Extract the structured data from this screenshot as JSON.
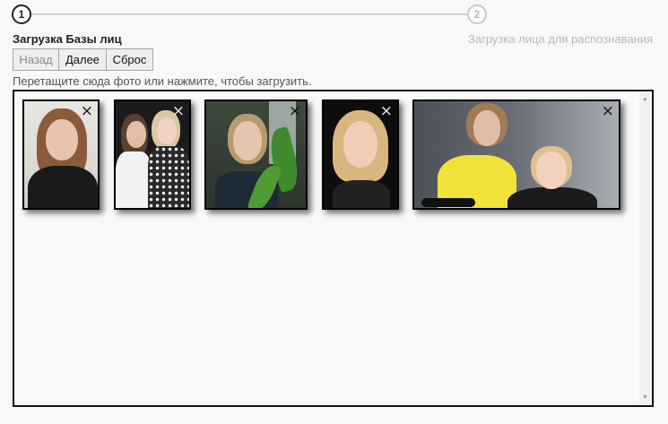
{
  "stepper": {
    "step1_number": "1",
    "step2_number": "2",
    "step1_title": "Загрузка Базы лиц",
    "step2_title": "Загрузка лица для распознавания"
  },
  "buttons": {
    "back": "Назад",
    "next": "Далее",
    "reset": "Сброс"
  },
  "dropzone": {
    "hint": "Перетащите сюда фото или нажмите, чтобы загрузить."
  },
  "thumbnails": [
    {
      "name": "photo-1",
      "remove": "×"
    },
    {
      "name": "photo-2",
      "remove": "×"
    },
    {
      "name": "photo-3",
      "remove": "×"
    },
    {
      "name": "photo-4",
      "remove": "×"
    },
    {
      "name": "photo-5",
      "remove": "×"
    }
  ],
  "scrollbar": {
    "up": "▲",
    "down": "▼"
  },
  "icons": [
    "close-icon",
    "scroll-up-icon",
    "scroll-down-icon"
  ],
  "colors": {
    "active_step": "#222222",
    "inactive_step": "#b8b8b8",
    "dropzone_border": "#111111"
  }
}
